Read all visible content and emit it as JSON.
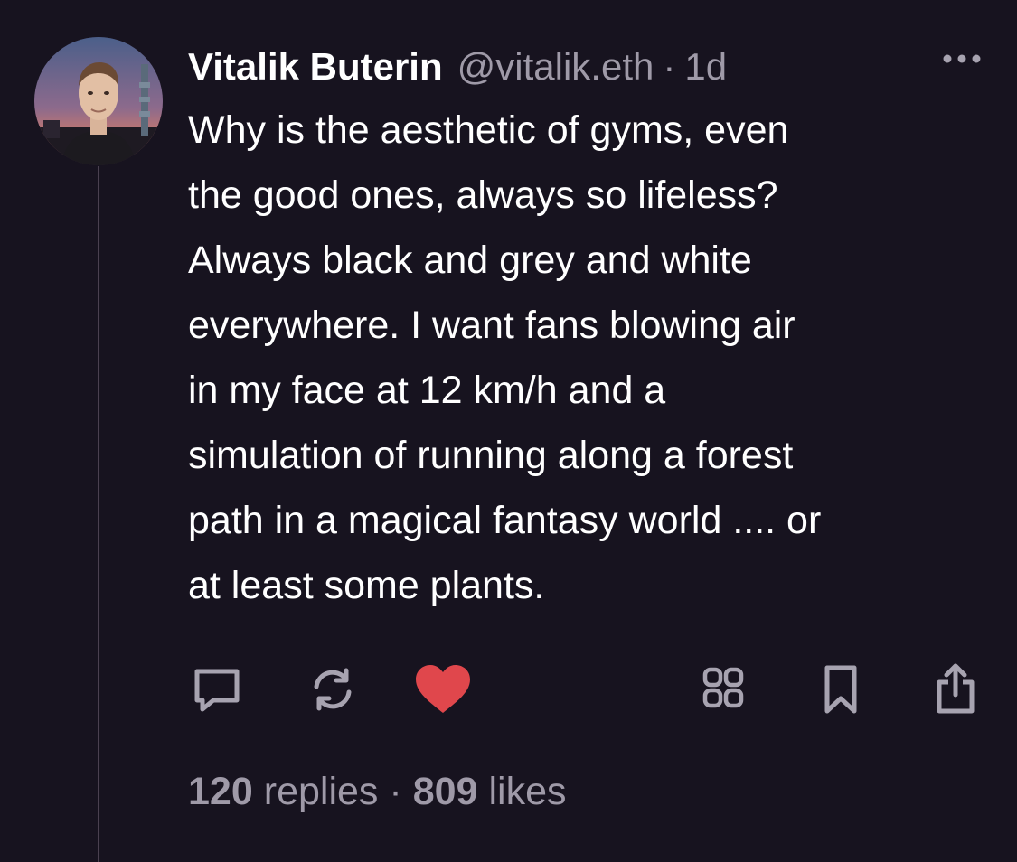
{
  "post": {
    "author_name": "Vitalik Buterin",
    "handle": "@vitalik.eth",
    "separator": "·",
    "time_ago": "1d",
    "text": "Why is the aesthetic of gyms, even\nthe good ones, always so lifeless?\nAlways black and grey and white\neverywhere. I want fans blowing air\nin my face at 12 km/h and a\nsimulation of running along a forest\npath in a magical fantasy world .... or\nat least some plants."
  },
  "actions": [
    {
      "icon": "comment-icon"
    },
    {
      "icon": "repost-icon"
    },
    {
      "icon": "heart-icon",
      "state": "liked"
    },
    {
      "icon": "grid-icon"
    },
    {
      "icon": "bookmark-icon"
    },
    {
      "icon": "share-icon"
    }
  ],
  "stats": {
    "replies_count": "120",
    "replies_label": "replies",
    "separator": "·",
    "likes_count": "809",
    "likes_label": "likes"
  },
  "colors": {
    "background": "#17131f",
    "text": "#ffffff",
    "muted": "#9f9aa8",
    "like": "#e0474c",
    "icon": "#a7a3b0",
    "thread_line": "#4a4150"
  }
}
